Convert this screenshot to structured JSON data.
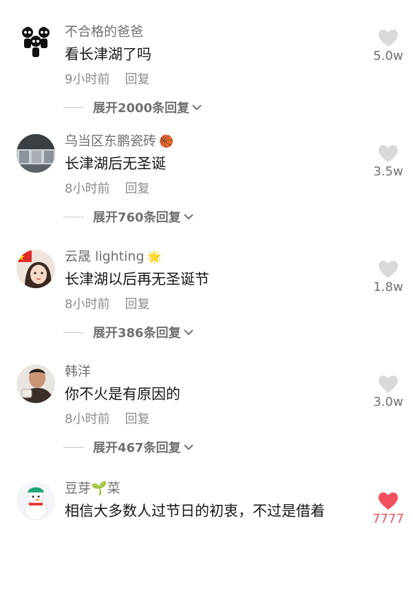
{
  "comments": [
    {
      "username": "不合格的爸爸",
      "badge": "",
      "text": "看长津湖了吗",
      "time": "9小时前",
      "reply": "回复",
      "expand": "展开2000条回复",
      "likes": "5.0w",
      "liked": false,
      "avatar_icon": "cartoon-trio-icon"
    },
    {
      "username": "乌当区东鹏瓷砖",
      "badge": "🏀",
      "text": "长津湖后无圣诞",
      "time": "8小时前",
      "reply": "回复",
      "expand": "展开760条回复",
      "likes": "3.5w",
      "liked": false,
      "avatar_icon": "storefront-photo-icon"
    },
    {
      "username": "云晟 lighting",
      "badge": "🌟",
      "text": "长津湖以后再无圣诞节",
      "time": "8小时前",
      "reply": "回复",
      "expand": "展开386条回复",
      "likes": "1.8w",
      "liked": false,
      "avatar_icon": "girl-flag-photo-icon"
    },
    {
      "username": "韩洋",
      "badge": "",
      "text": "你不火是有原因的",
      "time": "8小时前",
      "reply": "回复",
      "expand": "展开467条回复",
      "likes": "3.0w",
      "liked": false,
      "avatar_icon": "man-photo-icon"
    },
    {
      "username": "豆芽🌱菜",
      "badge": "",
      "text": "相信大多数人过节日的初衷，不过是借着",
      "time": "",
      "reply": "",
      "expand": "",
      "likes": "7777",
      "liked": true,
      "avatar_icon": "snowman-photo-icon"
    }
  ],
  "colors": {
    "like_gray": "#d9d9dc",
    "like_red": "#f2505c",
    "username": "#6f6f72",
    "meta": "#8b8b90"
  }
}
